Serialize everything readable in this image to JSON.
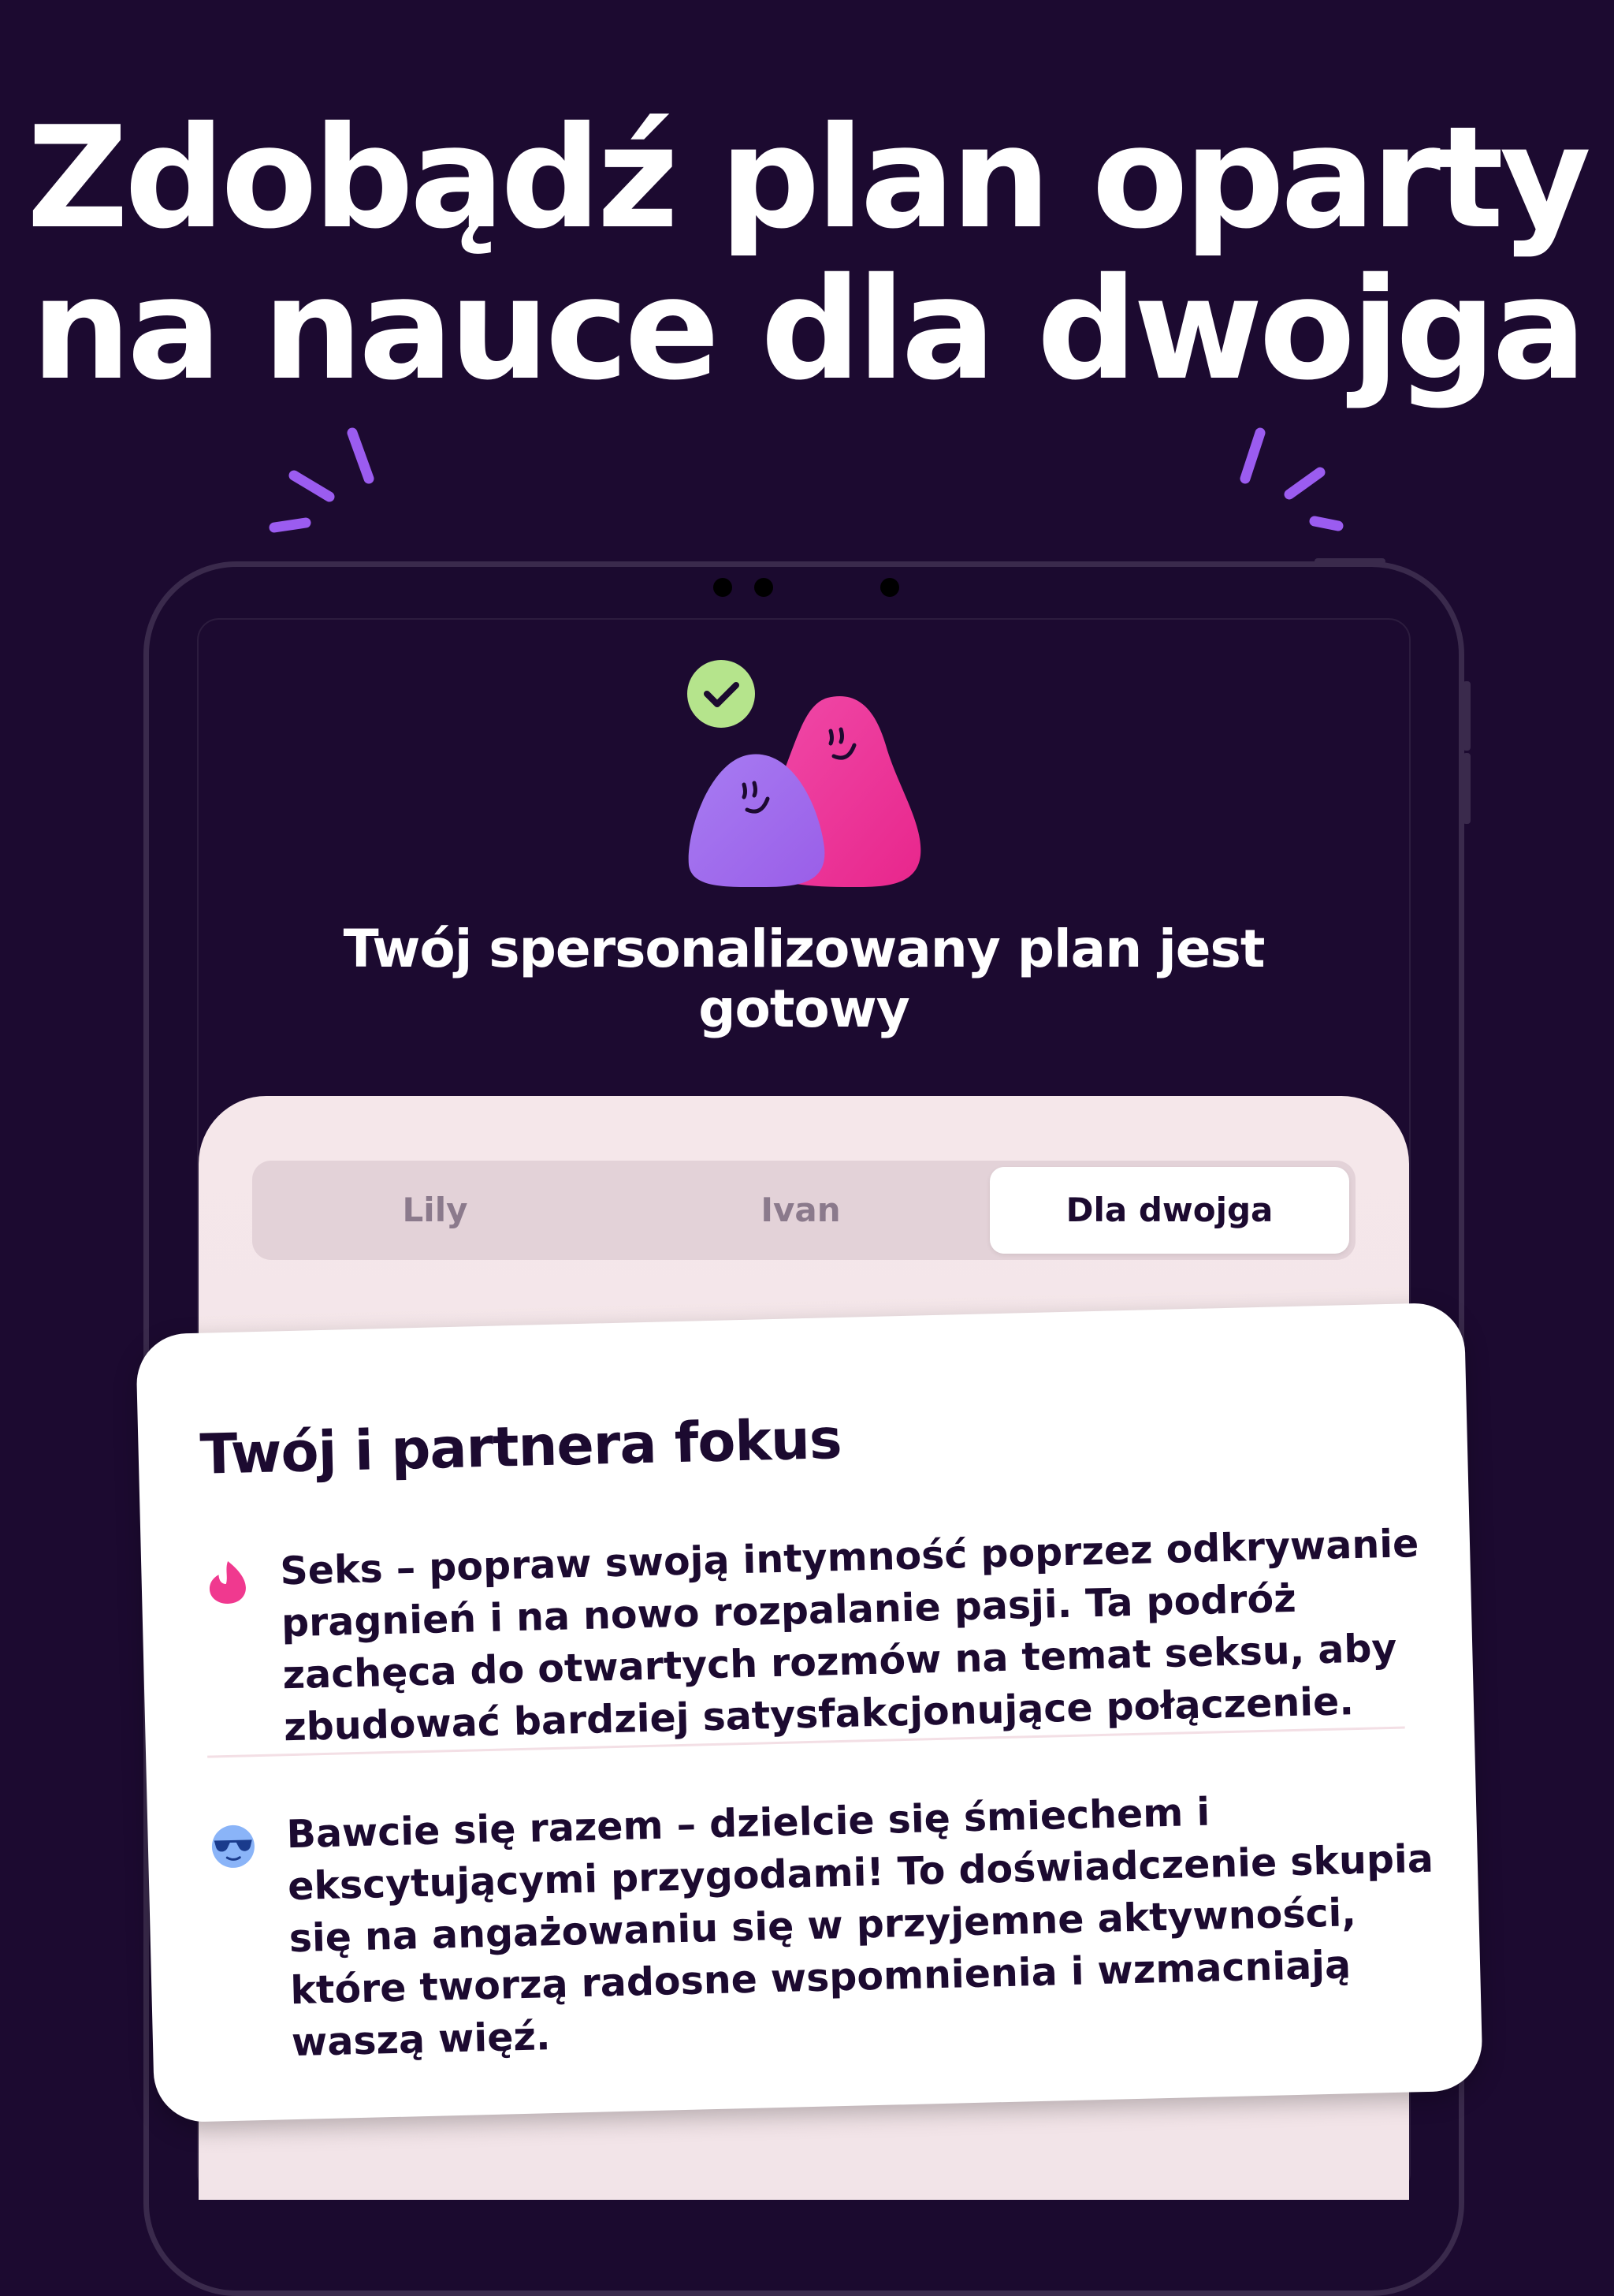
{
  "headline": {
    "line1": "Zdobądź plan oparty",
    "line2": "na nauce dla dwojga"
  },
  "screen": {
    "plan_title": "Twój spersonalizowany plan jest gotowy",
    "tabs": [
      {
        "label": "Lily",
        "active": false
      },
      {
        "label": "Ivan",
        "active": false
      },
      {
        "label": "Dla dwojga",
        "active": true
      }
    ]
  },
  "focus_card": {
    "title": "Twój i partnera fokus",
    "items": [
      {
        "icon": "flame-icon",
        "text": "Seks – popraw swoją intymność poprzez odkrywanie pragnień i na nowo rozpalanie pasji. Ta podróż zachęca do otwartych rozmów na temat seksu, aby zbudować bardziej satysfakcjonujące połączenie."
      },
      {
        "icon": "sunglasses-face-icon",
        "text": "Bawcie się razem – dzielcie się śmiechem i ekscytującymi przygodami! To doświadczenie skupia się na angażowaniu się w przyjemne aktywności, które tworzą radosne wspomnienia i wzmacniają waszą więź."
      }
    ]
  },
  "colors": {
    "background": "#1c0a30",
    "accent_purple": "#9b5cf0",
    "accent_pink": "#f03c9c",
    "check_green": "#b5e48c",
    "panel": "#f5e7ea",
    "text_dark": "#1c0a30"
  }
}
